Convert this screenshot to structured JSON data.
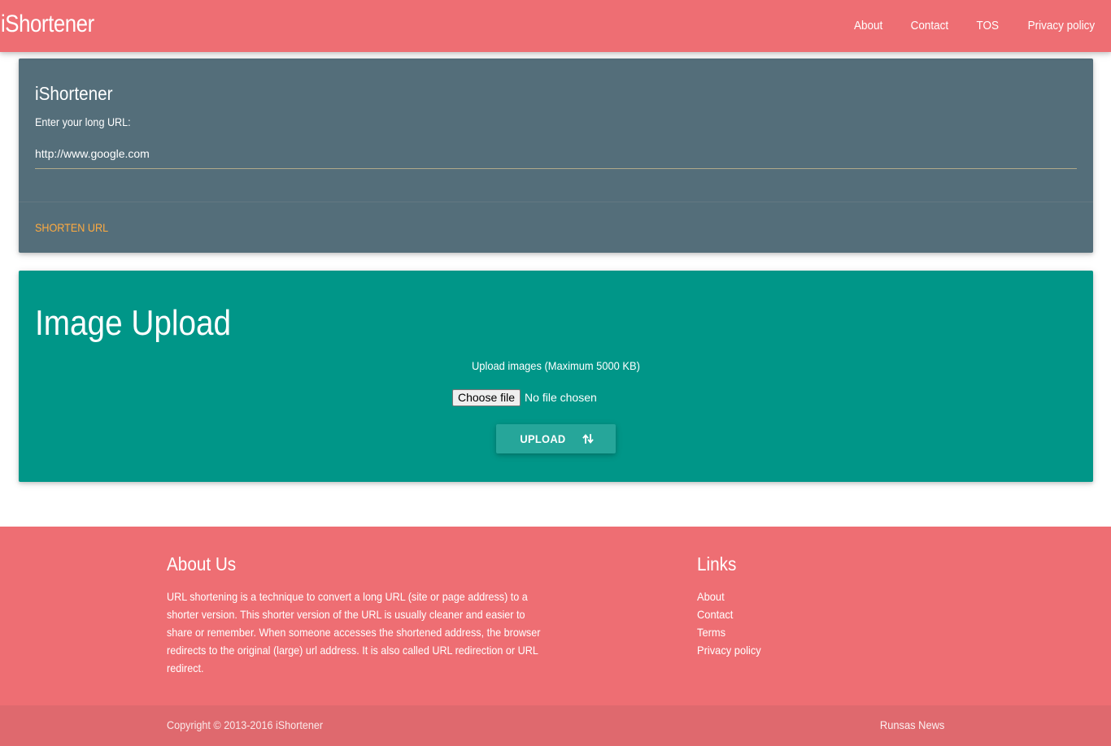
{
  "navbar": {
    "brand": "iShortener",
    "links": [
      {
        "label": "About"
      },
      {
        "label": "Contact"
      },
      {
        "label": "TOS"
      },
      {
        "label": "Privacy policy"
      }
    ]
  },
  "url_card": {
    "title": "iShortener",
    "field_label": "Enter your long URL:",
    "input_value": "http://www.google.com",
    "action_label": "SHORTEN URL"
  },
  "upload_card": {
    "title": "Image Upload",
    "caption": "Upload images (Maximum 5000 KB)",
    "choose_file_label": "Choose file",
    "file_status": "No file chosen",
    "upload_label": "UPLOAD",
    "upload_icon": "swap-vertical-icon"
  },
  "footer": {
    "about_heading": "About Us",
    "about_text": "URL shortening is a technique to convert a long URL (site or page address) to a shorter version. This shorter version of the URL is usually cleaner and easier to share or remember. When someone accesses the shortened address, the browser redirects to the original (large) url address. It is also called URL redirection or URL redirect.",
    "links_heading": "Links",
    "links": [
      {
        "label": "About"
      },
      {
        "label": "Contact"
      },
      {
        "label": "Terms"
      },
      {
        "label": "Privacy policy"
      }
    ],
    "copyright": "Copyright © 2013-2016 iShortener",
    "right_link": "Runsas News"
  },
  "colors": {
    "primary": "#ee6e73",
    "url_card_bg": "#546e7a",
    "upload_card_bg": "#009688",
    "upload_button_bg": "#26a69a",
    "accent": "#ffab40"
  }
}
